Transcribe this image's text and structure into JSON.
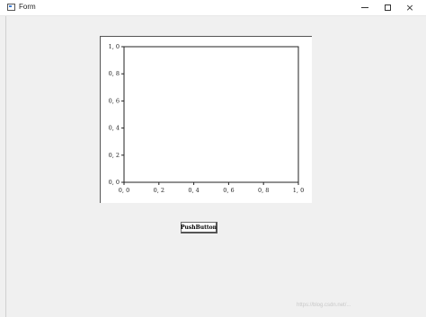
{
  "window": {
    "title": "Form",
    "controls": {
      "minimize": "minimize",
      "maximize": "maximize",
      "close": "×"
    }
  },
  "chart_data": {
    "type": "line",
    "series": [],
    "xlim": [
      0.0,
      1.0
    ],
    "ylim": [
      0.0,
      1.0
    ],
    "x_ticks": [
      "0, 0",
      "0, 2",
      "0, 4",
      "0, 6",
      "0, 8",
      "1, 0"
    ],
    "y_ticks": [
      "0, 0",
      "0, 2",
      "0, 4",
      "0, 6",
      "0, 8",
      "1, 0"
    ],
    "grid": false
  },
  "button": {
    "label": "PushButton"
  },
  "watermark": {
    "text": "https://blog.csdn.net/..."
  }
}
